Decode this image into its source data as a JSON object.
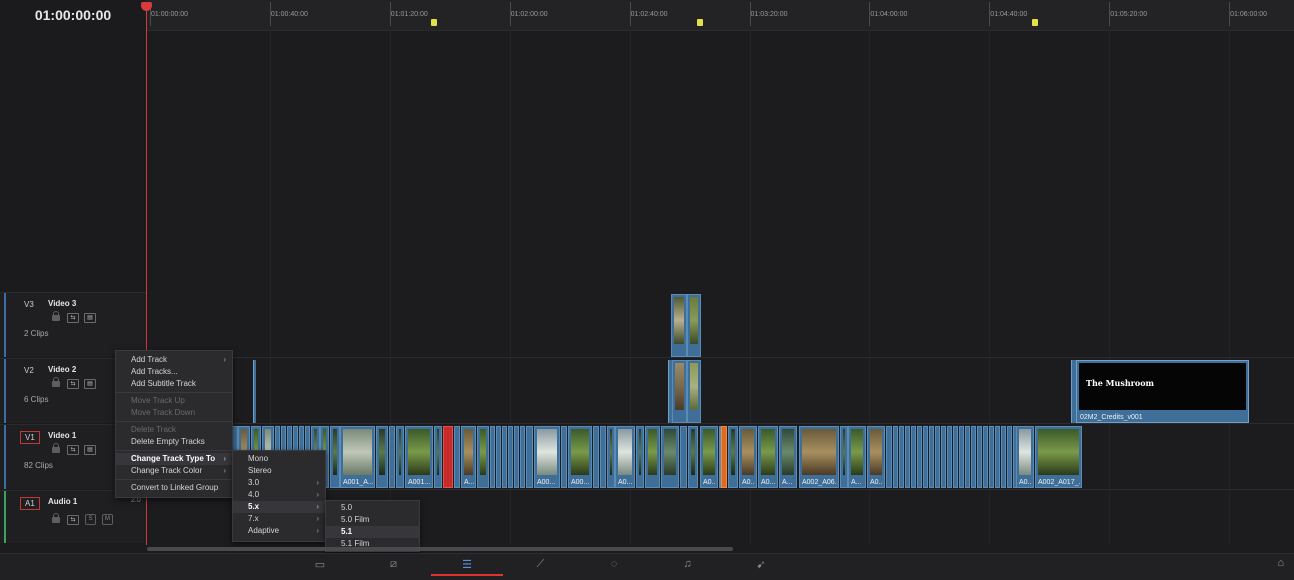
{
  "timecode": "01:00:00:00",
  "ruler": {
    "labels": [
      "01:00:00:00",
      "01:00:40:00",
      "01:01:20:00",
      "01:02:00:00",
      "01:02:40:00",
      "01:03:20:00",
      "01:04:00:00",
      "01:04:40:00",
      "01:05:20:00",
      "01:06:00:00"
    ]
  },
  "tracks": {
    "v3": {
      "id": "V3",
      "name": "Video 3",
      "clips": "2 Clips",
      "accent": "#3a6ea5"
    },
    "v2": {
      "id": "V2",
      "name": "Video 2",
      "clips": "6 Clips",
      "accent": "#3a6ea5"
    },
    "v1": {
      "id": "V1",
      "name": "Video 1",
      "clips": "82 Clips",
      "accent": "#3a6ea5"
    },
    "a1": {
      "id": "A1",
      "name": "Audio 1",
      "level": "2.0",
      "accent": "#3aa55e",
      "solo": "S",
      "mute": "M"
    }
  },
  "clips": {
    "credits_title": "The Mushroom",
    "credits_label": "02M2_Credits_v001",
    "v1_labels": [
      "A001_A...",
      "A001...",
      "A...",
      "A00...",
      "A00...",
      "A0...",
      "A0...",
      "A0...",
      "A0...",
      "A...",
      "A002_A06...",
      "A...",
      "A0...",
      "A0...",
      "A002_A017_..."
    ]
  },
  "context_menu": {
    "items": [
      {
        "label": "Add Track",
        "submenu": true,
        "disabled": false
      },
      {
        "label": "Add Tracks...",
        "submenu": false,
        "disabled": false
      },
      {
        "label": "Add Subtitle Track",
        "submenu": false,
        "disabled": false
      },
      {
        "label": "Move Track Up",
        "submenu": false,
        "disabled": true
      },
      {
        "label": "Move Track Down",
        "submenu": false,
        "disabled": true
      },
      {
        "label": "Delete Track",
        "submenu": false,
        "disabled": true
      },
      {
        "label": "Delete Empty Tracks",
        "submenu": false,
        "disabled": false
      },
      {
        "label": "Change Track Type To",
        "submenu": true,
        "disabled": false,
        "active": true
      },
      {
        "label": "Change Track Color",
        "submenu": true,
        "disabled": false
      },
      {
        "label": "Convert to Linked Group",
        "submenu": false,
        "disabled": false
      }
    ]
  },
  "track_type_menu": {
    "items": [
      {
        "label": "Mono",
        "submenu": false
      },
      {
        "label": "Stereo",
        "submenu": false
      },
      {
        "label": "3.0",
        "submenu": true
      },
      {
        "label": "4.0",
        "submenu": true
      },
      {
        "label": "5.x",
        "submenu": true,
        "active": true
      },
      {
        "label": "7.x",
        "submenu": true
      },
      {
        "label": "Adaptive",
        "submenu": true
      }
    ]
  },
  "surround_menu": {
    "items": [
      {
        "label": "5.0"
      },
      {
        "label": "5.0 Film"
      },
      {
        "label": "5.1",
        "active": true
      },
      {
        "label": "5.1 Film"
      }
    ]
  },
  "bottom_tabs": [
    {
      "name": "media-page-icon",
      "glyph": "▭"
    },
    {
      "name": "cut-page-icon",
      "glyph": "⧄"
    },
    {
      "name": "edit-page-icon",
      "glyph": "☰",
      "active": true
    },
    {
      "name": "fusion-page-icon",
      "glyph": "⟋"
    },
    {
      "name": "color-page-icon",
      "glyph": "◌"
    },
    {
      "name": "fairlight-page-icon",
      "glyph": "♫"
    },
    {
      "name": "deliver-page-icon",
      "glyph": "➹"
    }
  ],
  "home_glyph": "⌂",
  "colors": {
    "clip": "#3f6f99",
    "playhead": "#d03a3a",
    "marker": "#e5e04a",
    "red_clip": "#c92a2a",
    "orange_clip": "#e06a1f"
  }
}
